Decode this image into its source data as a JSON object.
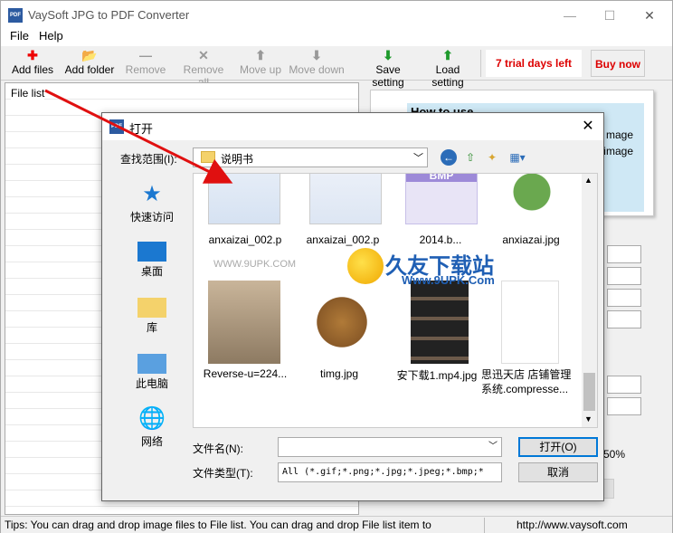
{
  "app": {
    "title": "VaySoft JPG to PDF Converter",
    "icon_text": "PDF",
    "window_controls": [
      "—",
      "☐",
      "✕"
    ]
  },
  "menu": [
    "File",
    "Help"
  ],
  "toolbar": {
    "add_files": "Add files",
    "add_folder": "Add folder",
    "remove": "Remove",
    "remove_all": "Remove all",
    "move_up": "Move up",
    "move_down": "Move down",
    "save_setting": "Save setting",
    "load_setting": "Load setting",
    "trial": "7 trial days left",
    "buy_now": "Buy now"
  },
  "file_list": {
    "label": "File list"
  },
  "howto": {
    "title": "How to use",
    "line1": "mage",
    "line2": "e image"
  },
  "right_panel": {
    "percent": "50%"
  },
  "status": {
    "tips": "Tips: You can drag and drop image files to File list. You can drag and drop File list item to",
    "url": "http://www.vaysoft.com"
  },
  "dialog": {
    "title": "打开",
    "icon_text": "PDF",
    "close": "✕",
    "look_in_label": "查找范围(I):",
    "look_in_value": "说明书",
    "places": [
      "快速访问",
      "桌面",
      "库",
      "此电脑",
      "网络"
    ],
    "files": [
      {
        "name": "anxaizai_002.p"
      },
      {
        "name": "anxaizai_002.p"
      },
      {
        "name": "2014.b..."
      },
      {
        "name": "anxiazai.jpg"
      },
      {
        "name": "Reverse-u=224..."
      },
      {
        "name": "timg.jpg"
      },
      {
        "name": "安下载1.mp4.jpg"
      },
      {
        "name": "思迅天店 店铺管理系统.compresse..."
      }
    ],
    "bmp_label": "BMP",
    "watermark": "久友下载站",
    "watermark_url": "Www.9UPK.Com",
    "watermark_www": "WWW.9UPK.COM",
    "file_name_label": "文件名(N):",
    "file_name_value": "",
    "file_type_label": "文件类型(T):",
    "file_type_value": "All (*.gif;*.png;*.jpg;*.jpeg;*.bmp;*",
    "open_button": "打开(O)",
    "cancel_button": "取消"
  },
  "colors": {
    "accent_red": "#dd0000",
    "toolbar_green": "#1e9a2c",
    "watermark_blue": "#1f5fb4"
  }
}
